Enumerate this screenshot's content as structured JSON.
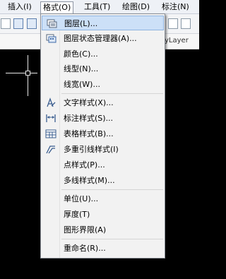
{
  "menubar": {
    "items": [
      {
        "label": "插入(I)"
      },
      {
        "label": "格式(O)"
      },
      {
        "label": "工具(T)"
      },
      {
        "label": "绘图(D)"
      },
      {
        "label": "标注(N)"
      }
    ]
  },
  "properties": {
    "linetype_value": "yLayer"
  },
  "format_menu": {
    "items": [
      {
        "label": "图层(L)...",
        "icon": "layer-icon"
      },
      {
        "label": "图层状态管理器(A)...",
        "icon": "layer-state-manager-icon"
      },
      {
        "label": "颜色(C)..."
      },
      {
        "label": "线型(N)..."
      },
      {
        "label": "线宽(W)..."
      },
      {
        "label": "文字样式(X)...",
        "icon": "text-style-icon"
      },
      {
        "label": "标注样式(S)...",
        "icon": "dimension-style-icon"
      },
      {
        "label": "表格样式(B)...",
        "icon": "table-style-icon"
      },
      {
        "label": "多重引线样式(I)",
        "icon": "multileader-style-icon"
      },
      {
        "label": "点样式(P)..."
      },
      {
        "label": "多线样式(M)..."
      },
      {
        "label": "单位(U)..."
      },
      {
        "label": "厚度(T)"
      },
      {
        "label": "图形界限(A)"
      },
      {
        "label": "重命名(R)..."
      }
    ]
  }
}
